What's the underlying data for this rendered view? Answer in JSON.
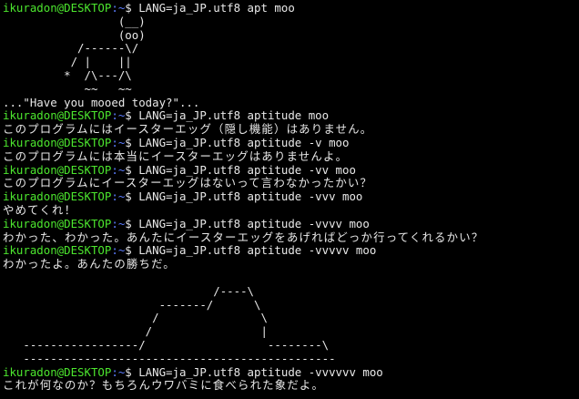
{
  "colors": {
    "background": "#000000",
    "text": "#e8e8e8",
    "prompt_user": "#4ce62e",
    "prompt_path": "#5b7cff"
  },
  "prompt": {
    "user_host": "ikuradon@DESKTOP",
    "path": ":~",
    "symbol": "$ "
  },
  "lines": [
    {
      "type": "cmd",
      "text": "LANG=ja_JP.utf8 apt moo"
    },
    {
      "type": "out",
      "text": "                 (__)"
    },
    {
      "type": "out",
      "text": "                 (oo)"
    },
    {
      "type": "out",
      "text": "           /------\\/"
    },
    {
      "type": "out",
      "text": "          / |    ||"
    },
    {
      "type": "out",
      "text": "         *  /\\---/\\"
    },
    {
      "type": "out",
      "text": "            ~~   ~~"
    },
    {
      "type": "out",
      "text": "...\"Have you mooed today?\"..."
    },
    {
      "type": "cmd",
      "text": "LANG=ja_JP.utf8 aptitude moo"
    },
    {
      "type": "jp",
      "text": "このプログラムにはイースターエッグ（隠し機能）はありません。"
    },
    {
      "type": "cmd",
      "text": "LANG=ja_JP.utf8 aptitude -v moo"
    },
    {
      "type": "jp",
      "text": "このプログラムには本当にイースターエッグはありませんよ。"
    },
    {
      "type": "cmd",
      "text": "LANG=ja_JP.utf8 aptitude -vv moo"
    },
    {
      "type": "jp",
      "text": "このプログラムにイースターエッグはないって言わなかったかい？"
    },
    {
      "type": "cmd",
      "text": "LANG=ja_JP.utf8 aptitude -vvv moo"
    },
    {
      "type": "jp",
      "text": "やめてくれ！"
    },
    {
      "type": "cmd",
      "text": "LANG=ja_JP.utf8 aptitude -vvvv moo"
    },
    {
      "type": "jp",
      "text": "わかった、わかった。あんたにイースターエッグをあげればどっか行ってくれるかい？"
    },
    {
      "type": "cmd",
      "text": "LANG=ja_JP.utf8 aptitude -vvvvv moo"
    },
    {
      "type": "jp",
      "text": "わかったよ。あんたの勝ちだ。"
    },
    {
      "type": "out",
      "text": ""
    },
    {
      "type": "out",
      "text": "                               /----\\"
    },
    {
      "type": "out",
      "text": "                       -------/      \\"
    },
    {
      "type": "out",
      "text": "                      /               \\"
    },
    {
      "type": "out",
      "text": "                     /                |"
    },
    {
      "type": "out",
      "text": "   -----------------/                  --------\\"
    },
    {
      "type": "out",
      "text": "   ----------------------------------------------"
    },
    {
      "type": "cmd",
      "text": "LANG=ja_JP.utf8 aptitude -vvvvvv moo"
    },
    {
      "type": "jp",
      "text": "これが何なのか？もちろんウワバミに食べられた象だよ。"
    }
  ]
}
